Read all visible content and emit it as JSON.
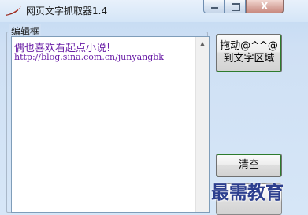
{
  "window": {
    "title": "网页文字抓取器1.4"
  },
  "caption": {
    "minimize_icon": "minimize-icon",
    "maximize_icon": "maximize-icon",
    "close_glyph": "X"
  },
  "editor_group": {
    "label": "编辑框",
    "lines": [
      "偶也喜欢看起点小说!",
      "http://blog.sina.com.cn/junyangbk"
    ]
  },
  "buttons": {
    "drag_label": "拖动@^^@到文字区域",
    "clear_label": "清空"
  },
  "watermark": {
    "text": "最需教育"
  },
  "colors": {
    "editor_text": "#6a1ea6",
    "button_focus_border": "#2d7b2d",
    "watermark": "#2c3f8f"
  }
}
